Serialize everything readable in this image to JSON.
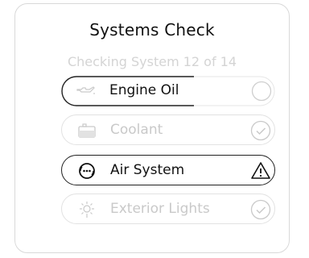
{
  "header": {
    "title": "Systems Check",
    "subtitle": "Checking System 12 of 14"
  },
  "items": [
    {
      "label": "Engine Oil",
      "icon": "oil-can-icon",
      "status": "in-progress",
      "status_icon": "empty-circle-icon"
    },
    {
      "label": "Coolant",
      "icon": "coolant-icon",
      "status": "complete",
      "status_icon": "check-circle-icon"
    },
    {
      "label": "Air System",
      "icon": "air-system-icon",
      "status": "warning",
      "status_icon": "warning-triangle-icon"
    },
    {
      "label": "Exterior Lights",
      "icon": "exterior-light-icon",
      "status": "complete",
      "status_icon": "check-circle-icon"
    }
  ]
}
